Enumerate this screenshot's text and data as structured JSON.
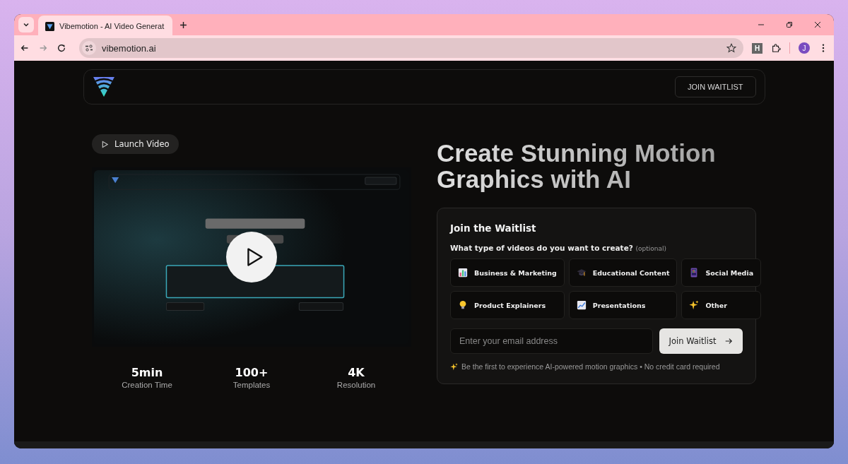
{
  "browser": {
    "tab": {
      "title": "Vibemotion - AI Video Generat",
      "selected": true
    },
    "address": "vibemotion.ai",
    "profile_initial": "J",
    "extension_label": "H"
  },
  "header": {
    "button": "JOIN WAITLIST"
  },
  "hero": {
    "launch_button": "Launch Video",
    "stats": [
      {
        "value": "5min",
        "label": "Creation Time"
      },
      {
        "value": "100+",
        "label": "Templates"
      },
      {
        "value": "4K",
        "label": "Resolution"
      }
    ]
  },
  "headline": "Create Stunning Motion Graphics with AI",
  "waitlist": {
    "title": "Join the Waitlist",
    "question": "What type of videos do you want to create?",
    "optional": "(optional)",
    "options": [
      {
        "kind": "bar-chart",
        "label": "Business & Marketing",
        "selected": false
      },
      {
        "kind": "cap",
        "label": "Educational Content",
        "selected": false
      },
      {
        "kind": "phone",
        "label": "Social Media",
        "selected": false
      },
      {
        "kind": "bulb",
        "label": "Product Explainers",
        "selected": false
      },
      {
        "kind": "line-chart",
        "label": "Presentations",
        "selected": false
      },
      {
        "kind": "sparkles",
        "label": "Other",
        "selected": false
      }
    ],
    "email_placeholder": "Enter your email address",
    "submit": "Join Waitlist",
    "note": "Be the first to experience AI-powered motion graphics • No credit card required"
  }
}
